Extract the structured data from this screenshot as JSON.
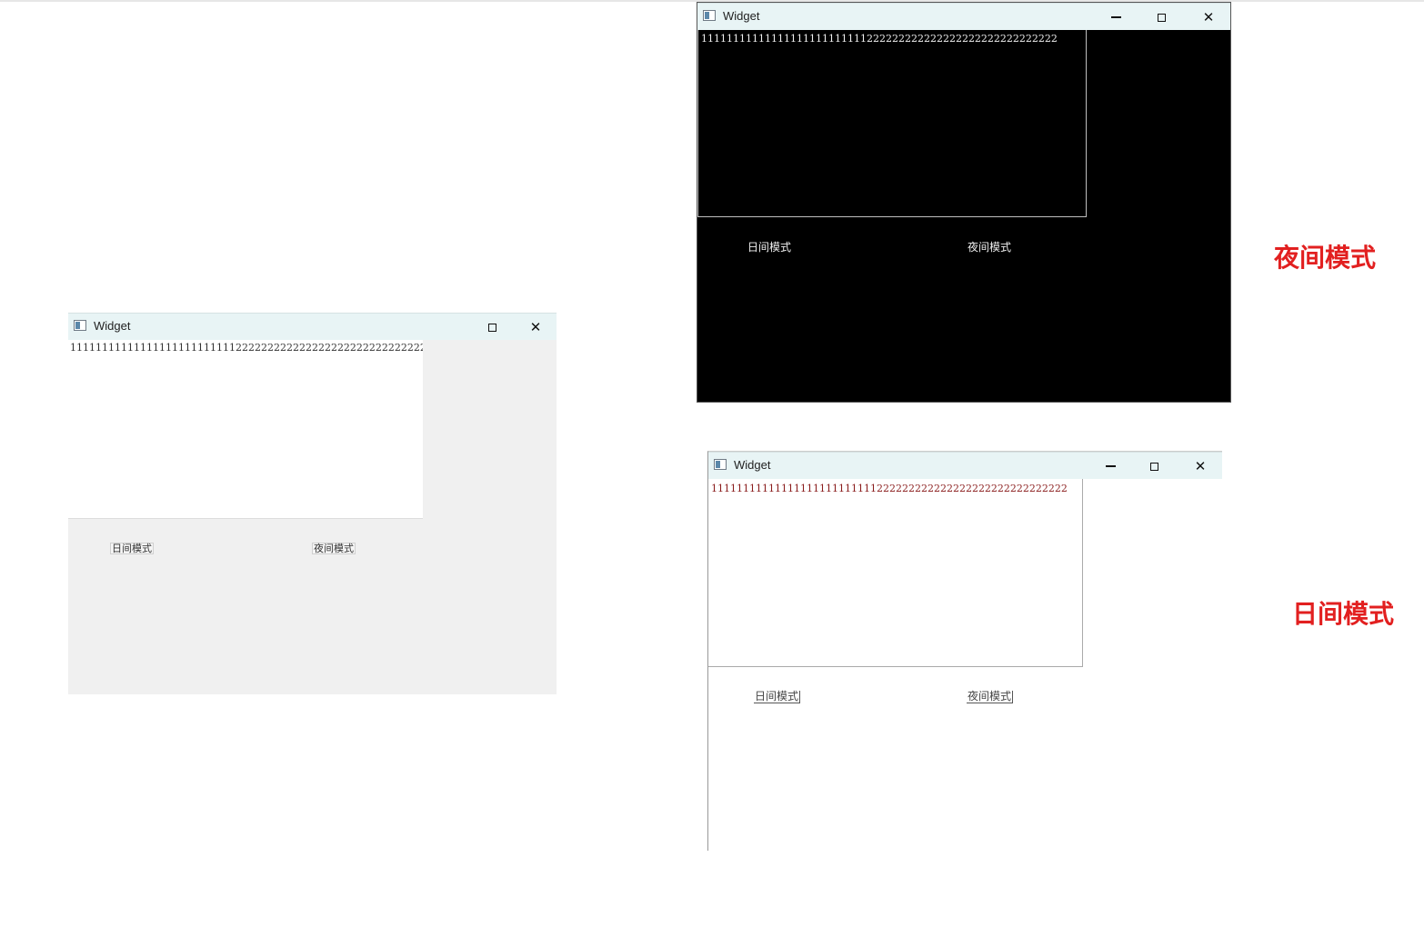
{
  "window_title": "Widget",
  "windows": {
    "left": {
      "title": "Widget",
      "text": "11111111111111111111111111222222222222222222222222222222",
      "day_button": "日间模式",
      "night_button": "夜间模式"
    },
    "night": {
      "title": "Widget",
      "text": "11111111111111111111111111222222222222222222222222222222",
      "day_button": "日间模式",
      "night_button": "夜间模式",
      "background": "#000000",
      "foreground": "#f0f0f0"
    },
    "day": {
      "title": "Widget",
      "text": "11111111111111111111111111222222222222222222222222222222",
      "day_button": "日间模式",
      "night_button": "夜间模式",
      "background": "#ffffff",
      "foreground": "#8a1c1c"
    }
  },
  "labels": {
    "night_mode": "夜间模式",
    "day_mode": "日间模式",
    "color": "#e22020"
  },
  "icons": [
    "app-window-icon",
    "minimize-icon",
    "maximize-icon",
    "close-icon"
  ]
}
